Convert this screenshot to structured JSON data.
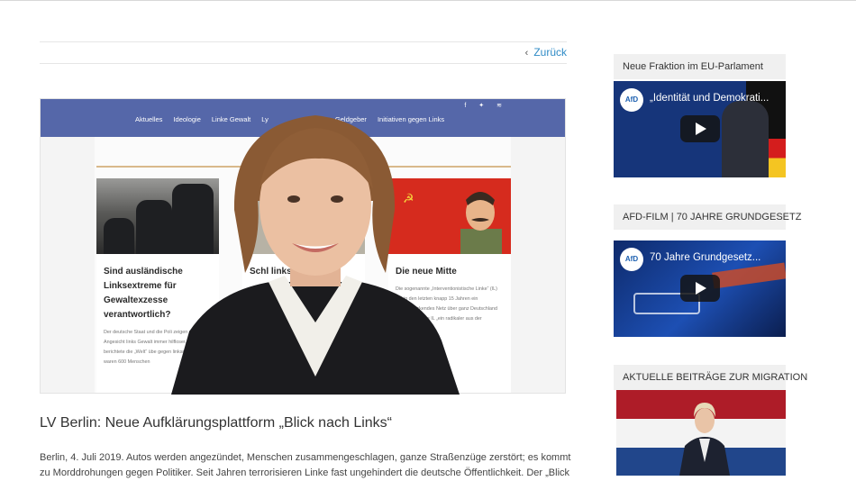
{
  "nav": {
    "back_label": "Zurück"
  },
  "hero": {
    "menu": [
      "Aktuelles",
      "Ideologie",
      "Linke Gewalt",
      "Ly",
      "Geldgeber",
      "Initiativen gegen Links"
    ],
    "social_icons": [
      "facebook-icon",
      "twitter-icon",
      "rss-icon"
    ],
    "cards": [
      {
        "title": "Sind ausländische Linksextreme für Gewaltexzesse verantwortlich?",
        "text": "Der deutsche Staat und die Poli zeigen sich im Angesicht links Gewalt immer hilfloser. Im berichtete die „Welt“ übe gegen linksradikale Ran waren 600 Menschen"
      },
      {
        "title": "Schl linksext",
        "text": "Seit Jah"
      },
      {
        "title": "Die neue Mitte",
        "text": "Die sogenannte „Interventionistische Linke“ (IL) hat in den letzten knapp 15 Jahren ein flächendeckendes Netz über ganz Deutschland gesponnen. Die IL „ein radikaler aus der"
      }
    ]
  },
  "article": {
    "title": "LV Berlin: Neue Aufklärungsplattform „Blick nach Links“",
    "body": "Berlin, 4. Juli 2019. Autos werden angezündet, Menschen zusammengeschlagen, ganze Straßenzüge zerstört; es kommt zu Morddrohungen gegen Politiker. Seit Jahren terrorisieren Linke fast ungehindert die deutsche Öffentlichkeit. Der „Blick"
  },
  "sidebar": {
    "widgets": [
      {
        "title": "Neue Fraktion im EU-Parlament",
        "video_title": "„Identität und Demokrati...",
        "video_logo": "AfD"
      },
      {
        "title": "AFD-FILM | 70 JAHRE GRUNDGESETZ",
        "video_title": "70 Jahre Grundgesetz...",
        "video_logo": "AfD"
      },
      {
        "title": "AKTUELLE BEITRÄGE ZUR MIGRATION"
      }
    ]
  },
  "colors": {
    "accent": "#2f8bc6",
    "hero_nav": "#5567a9",
    "flag_red": "#d62b1e"
  }
}
